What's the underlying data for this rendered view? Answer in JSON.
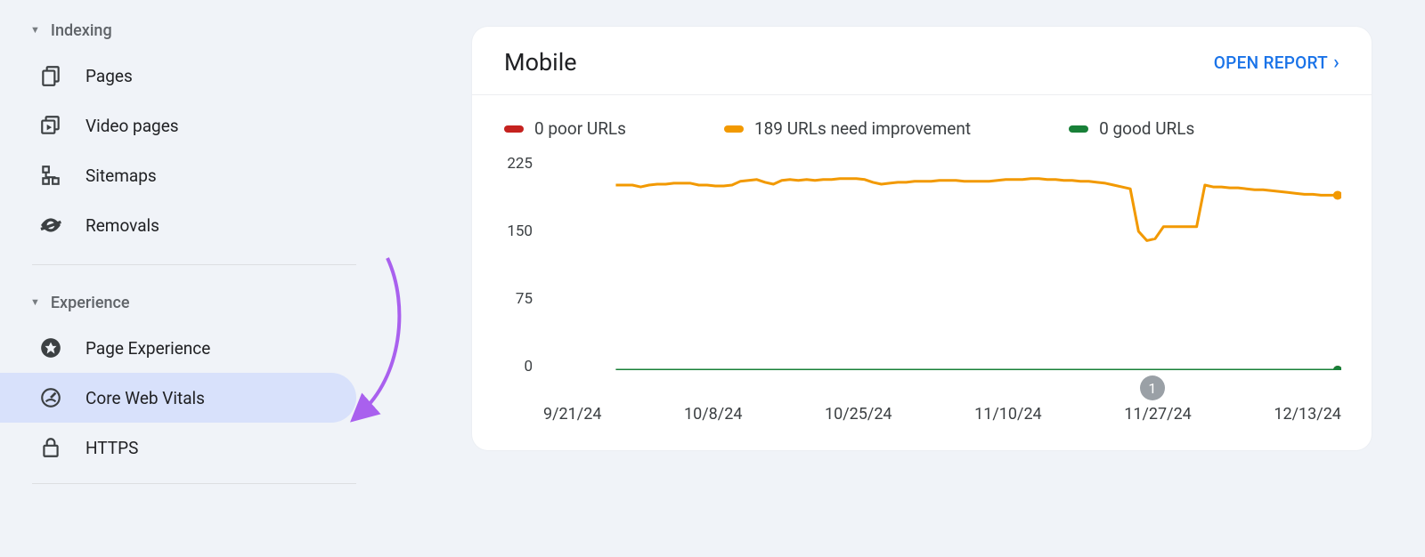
{
  "sidebar": {
    "sections": [
      {
        "title": "Indexing",
        "items": [
          {
            "label": "Pages"
          },
          {
            "label": "Video pages"
          },
          {
            "label": "Sitemaps"
          },
          {
            "label": "Removals"
          }
        ]
      },
      {
        "title": "Experience",
        "items": [
          {
            "label": "Page Experience"
          },
          {
            "label": "Core Web Vitals",
            "active": true
          },
          {
            "label": "HTTPS"
          }
        ]
      }
    ]
  },
  "card": {
    "title": "Mobile",
    "open_report": "OPEN REPORT"
  },
  "legend": {
    "poor": "0 poor URLs",
    "need": "189 URLs need improvement",
    "good": "0 good URLs"
  },
  "badge": "1",
  "chart_data": {
    "type": "line",
    "xlabel": "",
    "ylabel": "",
    "ylim": [
      0,
      225
    ],
    "y_ticks": [
      225,
      150,
      75,
      0
    ],
    "categories": [
      "9/21/24",
      "10/8/24",
      "10/25/24",
      "11/10/24",
      "11/27/24",
      "12/13/24"
    ],
    "series": [
      {
        "name": "poor",
        "color": "#c5221f",
        "values": [
          0,
          0,
          0,
          0,
          0,
          0,
          0,
          0,
          0,
          0,
          0,
          0,
          0,
          0,
          0,
          0,
          0,
          0,
          0,
          0,
          0,
          0,
          0,
          0,
          0,
          0,
          0,
          0,
          0,
          0,
          0,
          0,
          0,
          0,
          0,
          0,
          0,
          0,
          0,
          0,
          0,
          0,
          0,
          0,
          0,
          0,
          0,
          0,
          0,
          0,
          0,
          0,
          0,
          0,
          0,
          0,
          0,
          0,
          0,
          0,
          0,
          0,
          0,
          0,
          0,
          0,
          0,
          0,
          0,
          0,
          0,
          0,
          0,
          0,
          0,
          0,
          0,
          0,
          0,
          0,
          0,
          0,
          0,
          0,
          0,
          0,
          0,
          0
        ]
      },
      {
        "name": "needs_improvement",
        "color": "#f29900",
        "values": [
          200,
          200,
          200,
          198,
          200,
          201,
          201,
          202,
          202,
          202,
          200,
          200,
          199,
          199,
          200,
          204,
          205,
          206,
          203,
          201,
          205,
          206,
          205,
          206,
          205,
          206,
          206,
          207,
          207,
          207,
          206,
          203,
          201,
          202,
          203,
          203,
          204,
          204,
          204,
          205,
          205,
          205,
          204,
          204,
          204,
          204,
          205,
          206,
          206,
          206,
          207,
          207,
          206,
          206,
          205,
          205,
          204,
          204,
          203,
          202,
          200,
          198,
          196,
          150,
          140,
          142,
          155,
          155,
          155,
          155,
          155,
          200,
          198,
          198,
          197,
          197,
          196,
          195,
          195,
          194,
          193,
          192,
          191,
          190,
          190,
          189,
          189,
          189
        ]
      },
      {
        "name": "good",
        "color": "#188038",
        "values": [
          0,
          0,
          0,
          0,
          0,
          0,
          0,
          0,
          0,
          0,
          0,
          0,
          0,
          0,
          0,
          0,
          0,
          0,
          0,
          0,
          0,
          0,
          0,
          0,
          0,
          0,
          0,
          0,
          0,
          0,
          0,
          0,
          0,
          0,
          0,
          0,
          0,
          0,
          0,
          0,
          0,
          0,
          0,
          0,
          0,
          0,
          0,
          0,
          0,
          0,
          0,
          0,
          0,
          0,
          0,
          0,
          0,
          0,
          0,
          0,
          0,
          0,
          0,
          0,
          0,
          0,
          0,
          0,
          0,
          0,
          0,
          0,
          0,
          0,
          0,
          0,
          0,
          0,
          0,
          0,
          0,
          0,
          0,
          0,
          0,
          0,
          0,
          0
        ]
      }
    ],
    "annotations": [
      {
        "label": "1",
        "x_index": 66
      }
    ]
  }
}
